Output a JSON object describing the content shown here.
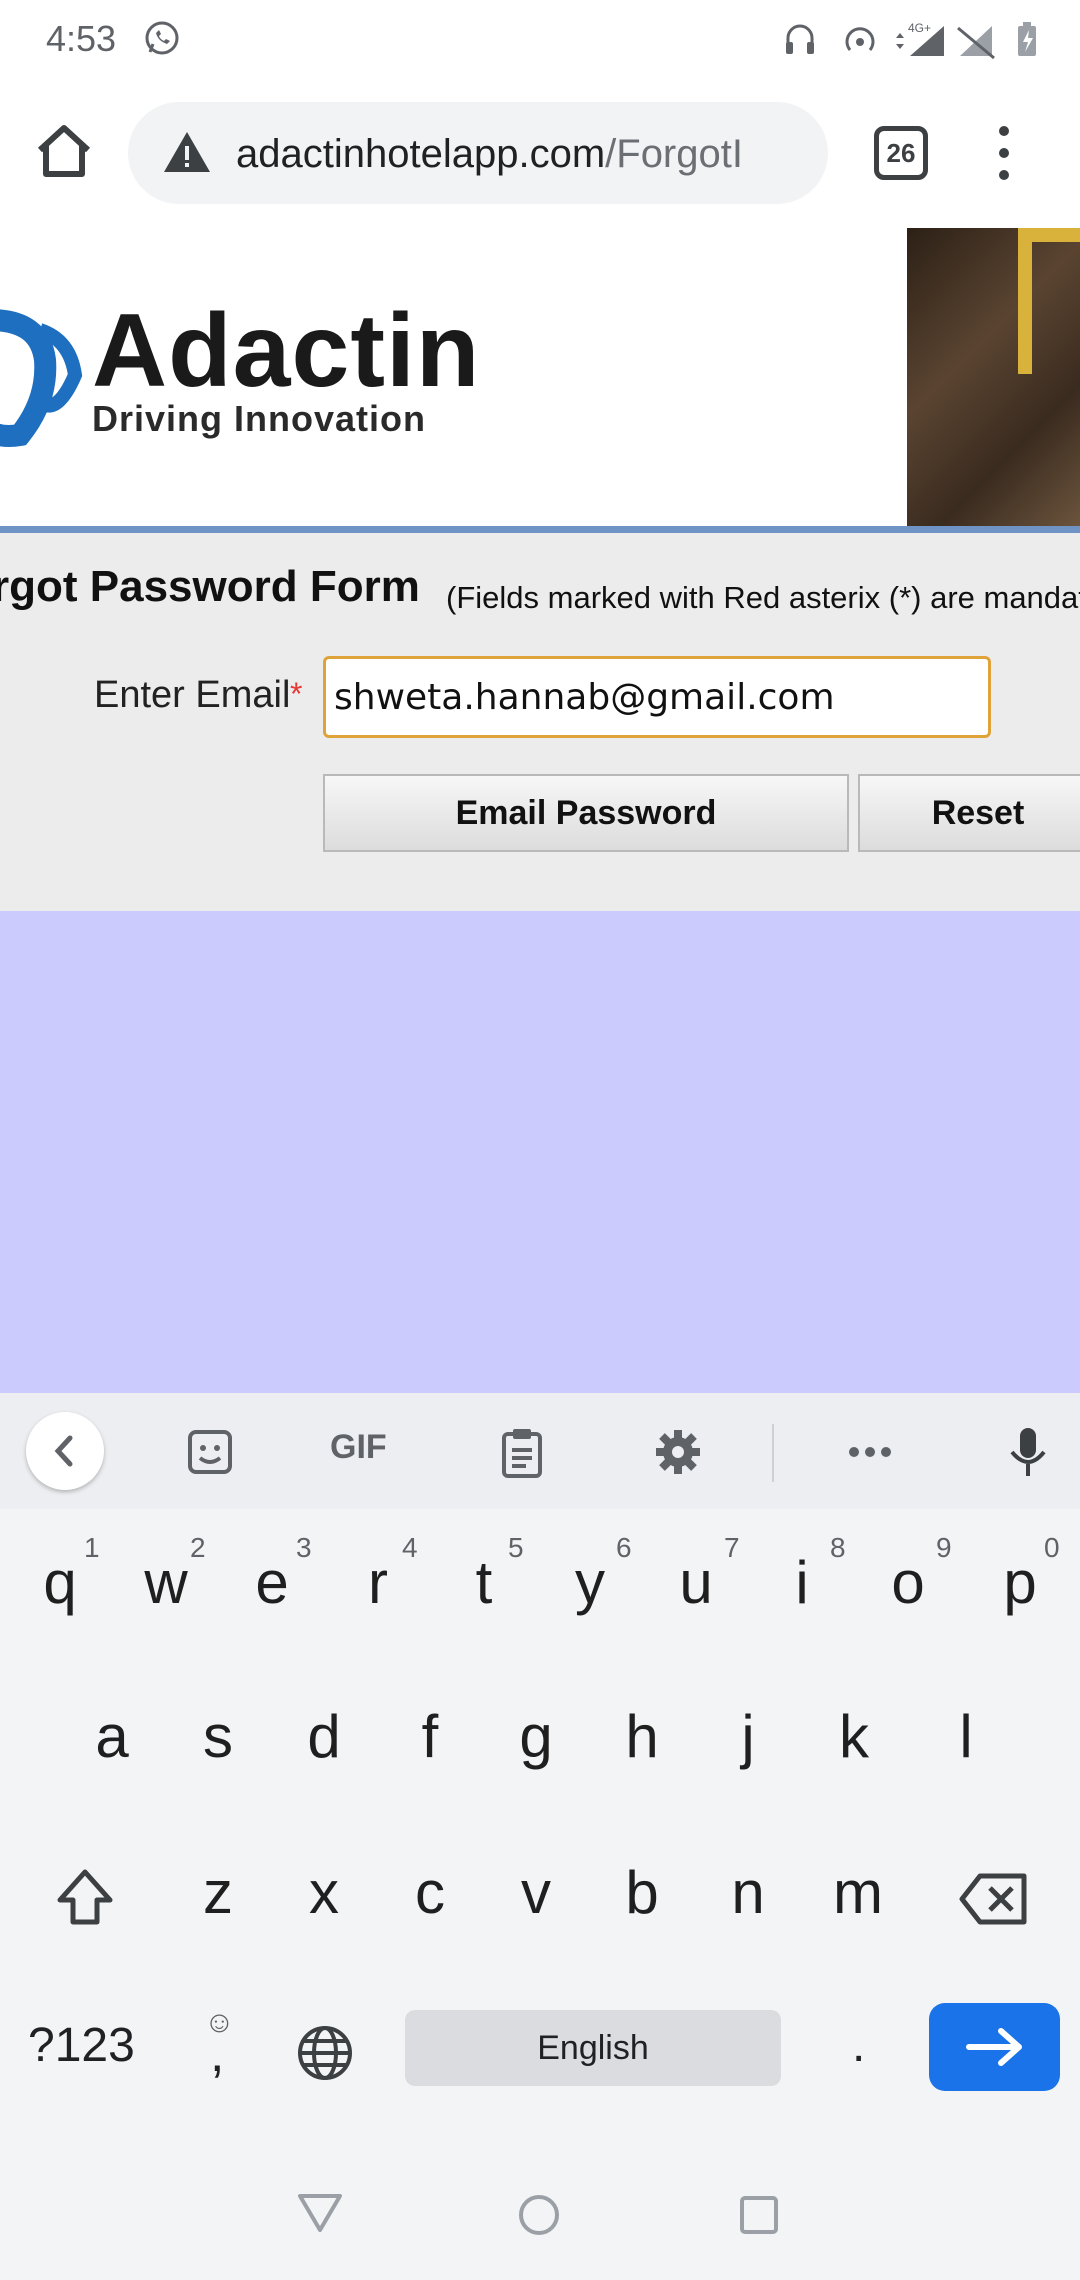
{
  "status_bar": {
    "time": "4:53",
    "network": "4G+"
  },
  "browser": {
    "url_main": "adactinhotelapp.com",
    "url_path": "/ForgotI",
    "tab_count": "26"
  },
  "header": {
    "logo_word": "Adactin",
    "logo_tagline": "Driving Innovation"
  },
  "form": {
    "title": "rgot Password Form",
    "note": "(Fields marked with Red asterix (*) are mandat",
    "email_label": "Enter Email",
    "required_mark": "*",
    "email_value": "shweta.hannab@gmail.com",
    "email_password_button": "Email Password",
    "reset_button": "Reset"
  },
  "keyboard": {
    "toolbar_gif": "GIF",
    "row1": [
      "q",
      "w",
      "e",
      "r",
      "t",
      "y",
      "u",
      "i",
      "o",
      "p"
    ],
    "row1_hints": [
      "1",
      "2",
      "3",
      "4",
      "5",
      "6",
      "7",
      "8",
      "9",
      "0"
    ],
    "row2": [
      "a",
      "s",
      "d",
      "f",
      "g",
      "h",
      "j",
      "k",
      "l"
    ],
    "row3": [
      "z",
      "x",
      "c",
      "v",
      "b",
      "n",
      "m"
    ],
    "symbols_key": "?123",
    "comma_key": ",",
    "space_label": "English",
    "period_key": "."
  },
  "colors": {
    "accent_input_border": "#e0a33a",
    "enter_key": "#1a73e8",
    "lavender_area": "#cccbfd",
    "header_rule": "#6e93c4"
  }
}
